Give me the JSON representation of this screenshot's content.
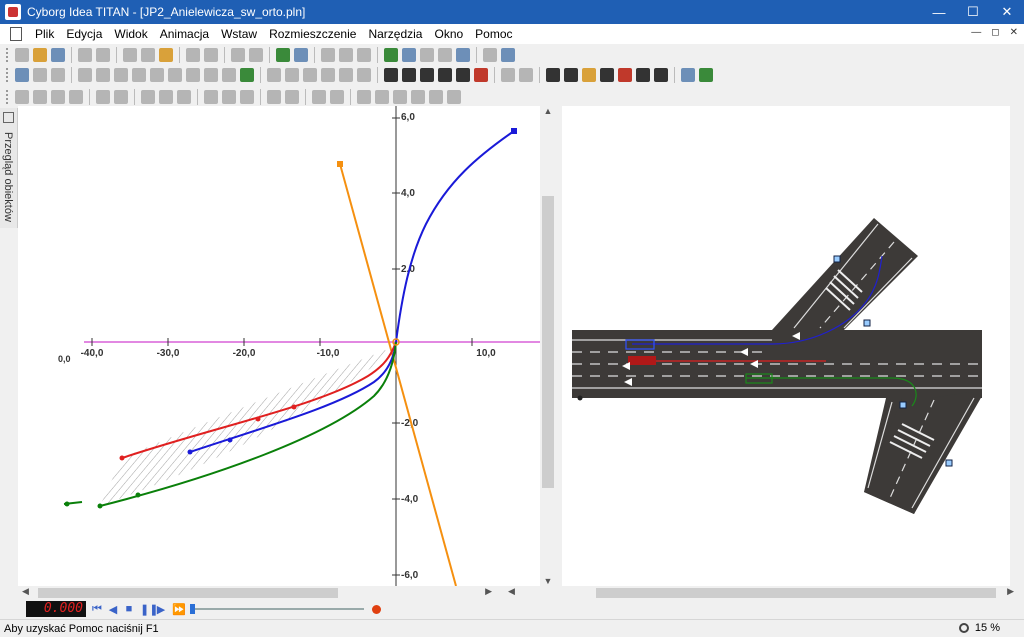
{
  "window": {
    "title": "Cyborg Idea TITAN - [JP2_Anielewicza_sw_orto.pln]"
  },
  "menu": [
    "Plik",
    "Edycja",
    "Widok",
    "Animacja",
    "Wstaw",
    "Rozmieszczenie",
    "Narzędzia",
    "Okno",
    "Pomoc"
  ],
  "side_panel": {
    "label": "Przegląd obiektów"
  },
  "graph": {
    "x_ticks": [
      "-40,0",
      "-30,0",
      "-20,0",
      "-10,0",
      "10,0"
    ],
    "y_ticks": [
      "6,0",
      "4,0",
      "2,0",
      "-2,0",
      "-4,0",
      "-6,0"
    ],
    "x_edge_label": "0,0",
    "colors": {
      "red": "#e02020",
      "blue": "#1a1ad8",
      "green": "#0a800a",
      "orange": "#f59010",
      "axis_h": "#d040d0"
    }
  },
  "playback": {
    "timer": "0.000"
  },
  "status": {
    "text": "Aby uzyskać Pomoc naciśnij F1",
    "zoom": "15 %"
  }
}
